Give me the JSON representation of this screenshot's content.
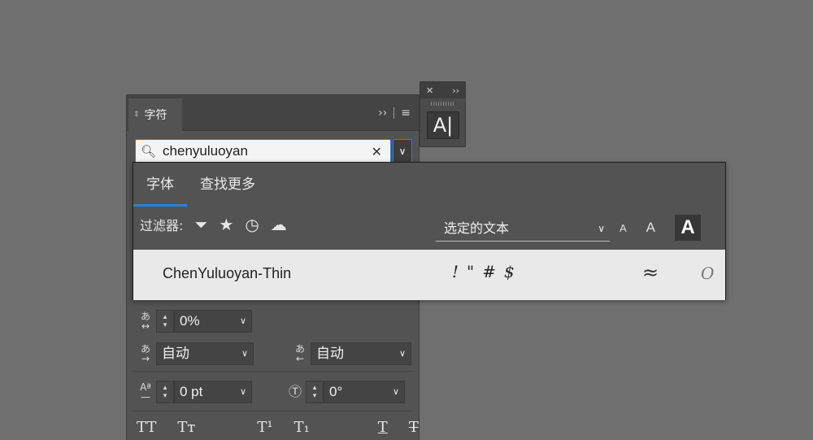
{
  "mini_panel": {
    "close_glyph": "✕",
    "expand_glyph": "››",
    "icon_glyph": "A|"
  },
  "panel": {
    "tab_label": "字符",
    "expand_glyph": "››",
    "menu_glyph": "≡"
  },
  "search": {
    "value": "chenyuluoyan",
    "clear_glyph": "✕",
    "dropdown_glyph": "∨"
  },
  "font_dropdown": {
    "tabs": [
      {
        "label": "字体",
        "active": true
      },
      {
        "label": "查找更多",
        "active": false
      }
    ],
    "filter_label": "过滤器:",
    "sample_text_label": "选定的文本",
    "size_labels": [
      "A",
      "A",
      "A"
    ],
    "results": [
      {
        "name": "ChenYuluoyan-Thin",
        "preview": "!\"#$",
        "similar_glyph": "≈",
        "type_glyph": "O"
      }
    ]
  },
  "fields": {
    "tracking": "0%",
    "space_before": "自动",
    "space_after": "自动",
    "baseline_shift": "0 pt",
    "rotation": "0°"
  },
  "typography_buttons": [
    "TT",
    "Tт",
    "T¹",
    "T₁",
    "T",
    "T"
  ],
  "colors": {
    "background": "#6f6f6f",
    "panel": "#535353",
    "accent": "#2a82d6",
    "result_row": "#e9e9e9"
  }
}
